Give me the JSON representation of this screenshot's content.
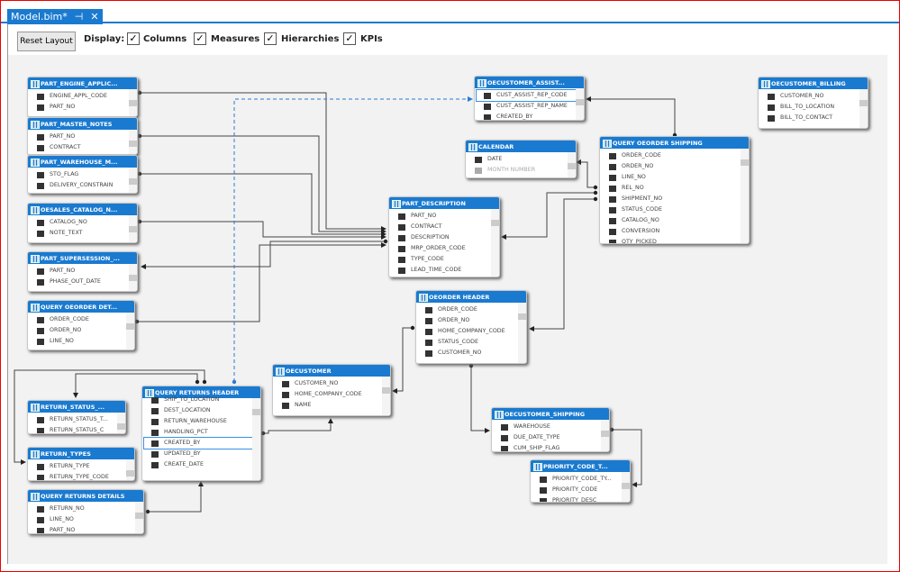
{
  "tab": {
    "title": "Model.bim*",
    "pin_icon": "pin-icon",
    "close_icon": "close-icon"
  },
  "toolbar": {
    "reset_label": "Reset Layout",
    "display_label": "Display:",
    "options": [
      {
        "label": "Columns",
        "checked": true
      },
      {
        "label": "Measures",
        "checked": true
      },
      {
        "label": "Hierarchies",
        "checked": true
      },
      {
        "label": "KPIs",
        "checked": true
      }
    ]
  },
  "tables": [
    {
      "name": "PART_ENGINE_APPLIC...",
      "columns": [
        "ENGINE_APPL_CODE",
        "PART_NO"
      ]
    },
    {
      "name": "PART_MASTER_NOTES",
      "columns": [
        "PART_NO",
        "CONTRACT"
      ]
    },
    {
      "name": "PART_WAREHOUSE_M...",
      "columns": [
        "STO_FLAG",
        "DELIVERY_CONSTRAIN",
        "CAP_QTY"
      ]
    },
    {
      "name": "OESALES_CATALOG_N...",
      "columns": [
        "CATALOG_NO",
        "NOTE_TEXT"
      ]
    },
    {
      "name": "PART_SUPERSESSION_...",
      "columns": [
        "PART_NO",
        "PHASE_OUT_DATE"
      ]
    },
    {
      "name": "QUERY OEORDER DET...",
      "columns": [
        "ORDER_CODE",
        "ORDER_NO",
        "LINE_NO"
      ]
    },
    {
      "name": "RETURN_STATUS_...",
      "columns": [
        "RETURN_STATUS_T...",
        "RETURN_STATUS_C"
      ]
    },
    {
      "name": "RETURN_TYPES",
      "columns": [
        "RETURN_TYPE",
        "RETURN_TYPE_CODE"
      ]
    },
    {
      "name": "QUERY RETURNS DETAILS",
      "columns": [
        "RETURN_NO",
        "LINE_NO",
        "PART_NO"
      ]
    },
    {
      "name": "QUERY RETURNS HEADER",
      "columns": [
        "SHIP_TO_LOCATION",
        "DEST_LOCATION",
        "RETURN_WAREHOUSE",
        "HANDLING_PCT",
        "CREATED_BY",
        "UPDATED_BY",
        "CREATE_DATE"
      ],
      "selected": "CREATED_BY"
    },
    {
      "name": "OECUSTOMER",
      "columns": [
        "CUSTOMER_NO",
        "HOME_COMPANY_CODE",
        "NAME"
      ]
    },
    {
      "name": "PART_DESCRIPTION",
      "columns": [
        "PART_NO",
        "CONTRACT",
        "DESCRIPTION",
        "MRP_ORDER_CODE",
        "TYPE_CODE",
        "LEAD_TIME_CODE"
      ]
    },
    {
      "name": "OEORDER HEADER",
      "columns": [
        "ORDER_CODE",
        "ORDER_NO",
        "HOME_COMPANY_CODE",
        "STATUS_CODE",
        "CUSTOMER_NO"
      ]
    },
    {
      "name": "OECUSTOMER_ASSIST...",
      "columns": [
        "CUST_ASSIST_REP_CODE",
        "CUST_ASSIST_REP_NAME",
        "CREATED_BY"
      ],
      "selected": "CUST_ASSIST_REP_CODE"
    },
    {
      "name": "CALENDAR",
      "columns": [
        "DATE",
        "MONTH NUMBER"
      ],
      "dimmed": "MONTH NUMBER"
    },
    {
      "name": "QUERY OEORDER SHIPPING",
      "columns": [
        "ORDER_CODE",
        "ORDER_NO",
        "LINE_NO",
        "REL_NO",
        "SHIPMENT_NO",
        "STATUS_CODE",
        "CATALOG_NO",
        "CONVERSION",
        "QTY_PICKED"
      ]
    },
    {
      "name": "OECUSTOMER_BILLING",
      "columns": [
        "CUSTOMER_NO",
        "BILL_TO_LOCATION",
        "BILL_TO_CONTACT"
      ]
    },
    {
      "name": "OECUSTOMER_SHIPPING",
      "columns": [
        "WAREHOUSE",
        "DUE_DATE_TYPE",
        "CUM_SHIP_FLAG"
      ]
    },
    {
      "name": "PRIORITY_CODE_T...",
      "columns": [
        "PRIORITY_CODE_TY...",
        "PRIORITY_CODE",
        "PRIORITY_DESC"
      ]
    }
  ],
  "colors": {
    "accent": "#1a7ad0",
    "canvas": "#f2f2f2",
    "selection": "#3a8ee6"
  }
}
